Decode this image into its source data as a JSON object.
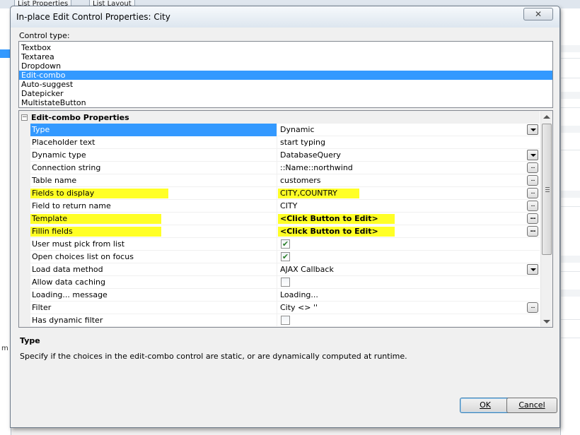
{
  "background": {
    "tabs": [
      "List Properties",
      "List Layout"
    ],
    "left_fragment": "m"
  },
  "dialog": {
    "title": "In-place Edit Control Properties: City",
    "close_symbol": "✕"
  },
  "control_type": {
    "label": "Control type:",
    "items": [
      "Textbox",
      "Textarea",
      "Dropdown",
      "Edit-combo",
      "Auto-suggest",
      "Datepicker",
      "MultistateButton"
    ],
    "selected": "Edit-combo"
  },
  "properties": {
    "category": "Edit-combo Properties",
    "collapse_symbol": "−",
    "highlight_color": "#ffff00",
    "selection_color": "#3399ff",
    "rows": [
      {
        "name": "Type",
        "value": "Dynamic",
        "editor": "dropdown",
        "selected": true
      },
      {
        "name": "Placeholder text",
        "value": "start typing",
        "editor": "none"
      },
      {
        "name": "Dynamic type",
        "value": "DatabaseQuery",
        "editor": "dropdown"
      },
      {
        "name": "Connection string",
        "value": "::Name::northwind",
        "editor": "ellipsis"
      },
      {
        "name": "Table name",
        "value": "customers",
        "editor": "ellipsis"
      },
      {
        "name": "Fields to display",
        "value": "CITY,COUNTRY",
        "editor": "ellipsis",
        "highlight": true
      },
      {
        "name": "Field to return name",
        "value": "CITY",
        "editor": "ellipsis"
      },
      {
        "name": "Template",
        "value": "<Click Button to Edit>",
        "editor": "ellipsis",
        "highlight": true,
        "bold": true
      },
      {
        "name": "Fillin fields",
        "value": "<Click Button to Edit>",
        "editor": "ellipsis",
        "highlight": true,
        "bold": true
      },
      {
        "name": "User must pick from list",
        "value": "",
        "editor": "checkbox",
        "checked": true
      },
      {
        "name": "Open choices list on focus",
        "value": "",
        "editor": "checkbox",
        "checked": true
      },
      {
        "name": "Load data method",
        "value": "AJAX Callback",
        "editor": "dropdown"
      },
      {
        "name": "Allow data caching",
        "value": "",
        "editor": "checkbox",
        "checked": false
      },
      {
        "name": "Loading... message",
        "value": "Loading...",
        "editor": "none"
      },
      {
        "name": "Filter",
        "value": "City <> ''",
        "editor": "ellipsis"
      },
      {
        "name": "Has dynamic filter",
        "value": "",
        "editor": "checkbox",
        "checked": false
      }
    ],
    "ellipsis_symbol": "...",
    "check_symbol": "✔"
  },
  "description": {
    "title": "Type",
    "text": "Specify if the choices in the edit-combo control are static, or are dynamically computed at runtime."
  },
  "buttons": {
    "ok": "OK",
    "cancel": "Cancel"
  }
}
